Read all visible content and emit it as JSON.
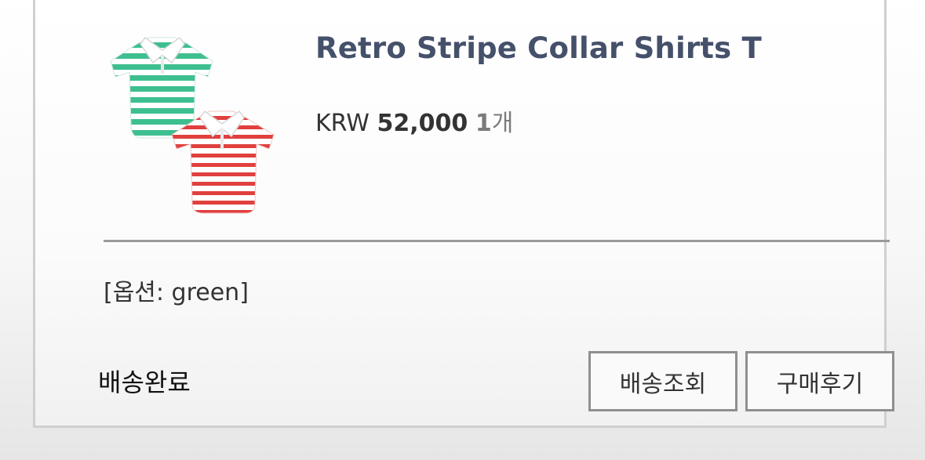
{
  "product": {
    "name": "Retro Stripe Collar Shirts T",
    "currency": "KRW",
    "price": "52,000",
    "quantity_number": "1",
    "quantity_unit": "개",
    "option": "[옵션: green]",
    "image_icon": "striped-polo-shirts-thumbnail"
  },
  "order": {
    "status": "배송완료"
  },
  "actions": {
    "track_label": "배송조회",
    "review_label": "구매후기"
  },
  "colors": {
    "title": "#45506a",
    "green_stripe": "#3dbf8f",
    "red_stripe": "#e0403e",
    "button_border": "#8f8f8f"
  }
}
